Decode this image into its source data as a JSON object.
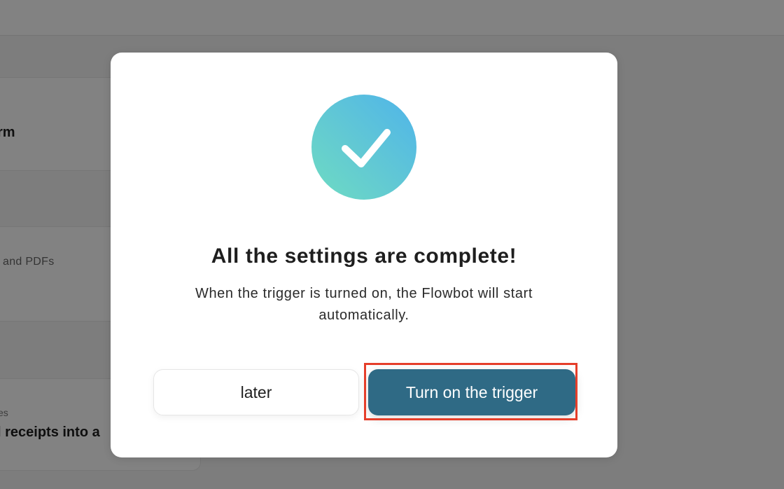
{
  "background": {
    "card_1_title": "rm",
    "card_2_subtitle": "and PDFs",
    "card_3_subtitle": "es",
    "card_3_title": "l receipts into a"
  },
  "modal": {
    "icon": "checkmark-icon",
    "title": "All the settings are complete!",
    "description": "When the trigger is turned on, the Flowbot will start automatically.",
    "later_button": "later",
    "trigger_button": "Turn on the trigger"
  },
  "colors": {
    "primary_button": "#2f6a85",
    "highlight": "#e53e2a",
    "check_gradient_start": "#6edcc2",
    "check_gradient_end": "#4fb4ea"
  }
}
